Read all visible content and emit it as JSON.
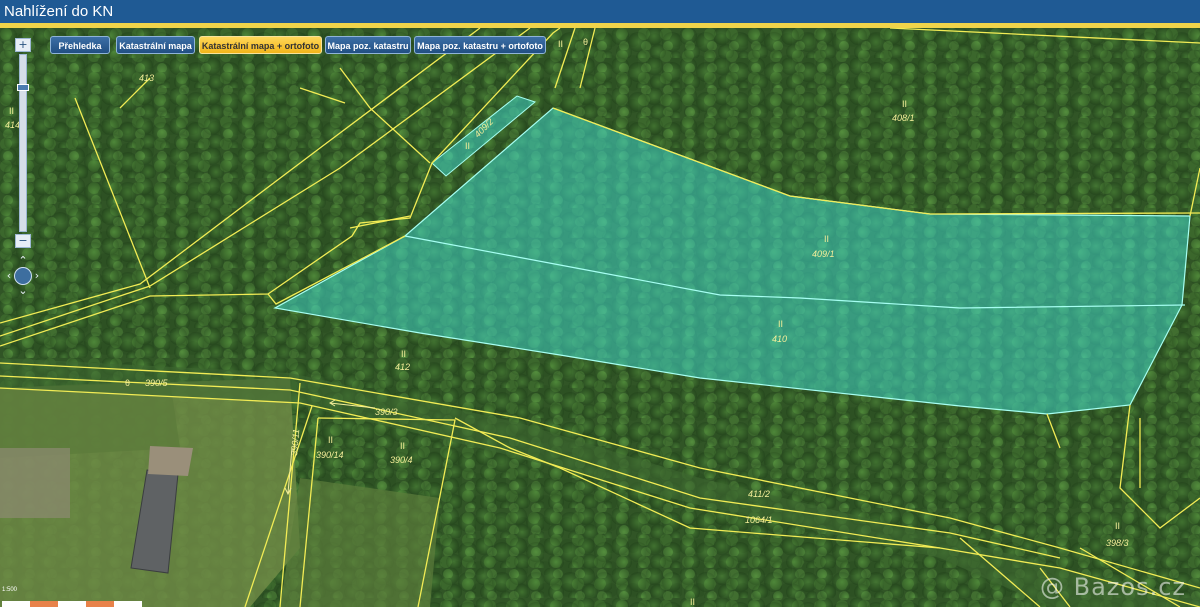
{
  "window": {
    "title": "Nahlížení do KN"
  },
  "layers": [
    {
      "label": "Přehledka",
      "active": false
    },
    {
      "label": "Katastrální mapa",
      "active": false
    },
    {
      "label": "Katastrální mapa + ortofoto",
      "active": true
    },
    {
      "label": "Mapa poz. katastru",
      "active": false
    },
    {
      "label": "Mapa poz. katastru + ortofoto",
      "active": false
    }
  ],
  "zoom": {
    "plus": "+",
    "minus": "−",
    "level_fraction": 0.17
  },
  "pan": {
    "up": "⌃",
    "down": "⌄",
    "left": "‹",
    "right": "›"
  },
  "parcels": {
    "p413": "413",
    "p414": "414",
    "p409_2": "409/2",
    "p408_1": "408/1",
    "p409_1": "409/1",
    "p410": "410",
    "p412": "412",
    "p390_5": "390/5",
    "p390_3": "390/3",
    "p390_11": "390/11",
    "p390_14": "390/14",
    "p390_4": "390/4",
    "p411_2": "411/2",
    "p1064_1": "1064/1",
    "p398_3": "398/3"
  },
  "marks": {
    "forest": "II",
    "road": "θ"
  },
  "scale": {
    "text": "1:500"
  },
  "watermark": "@ Bazos.cz",
  "colors": {
    "highlight": "#3fd6c8",
    "parcel_line": "#f2ec55",
    "title_bg": "#1f5a94",
    "active_btn": "#f2b51a"
  }
}
